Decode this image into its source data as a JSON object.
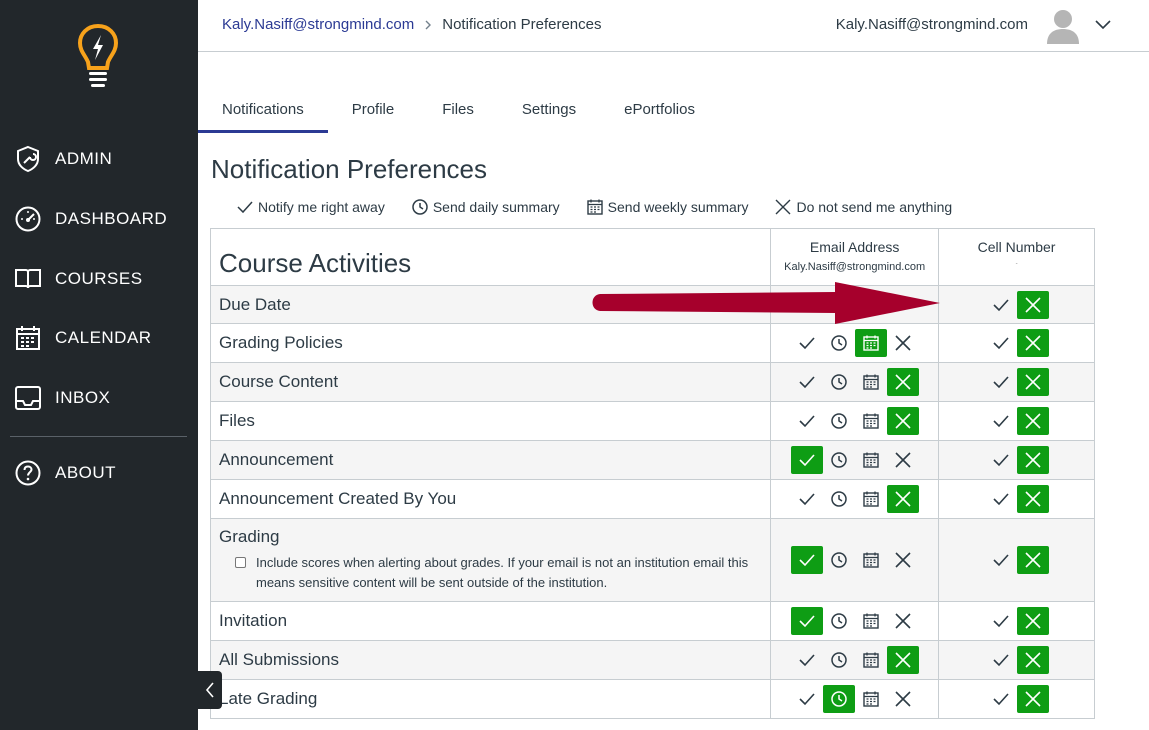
{
  "sidebar": {
    "items": [
      {
        "label": "ADMIN",
        "icon": "shield-wrench-icon"
      },
      {
        "label": "DASHBOARD",
        "icon": "speedometer-icon"
      },
      {
        "label": "COURSES",
        "icon": "book-icon"
      },
      {
        "label": "CALENDAR",
        "icon": "calendar-icon"
      },
      {
        "label": "INBOX",
        "icon": "inbox-icon"
      },
      {
        "label": "ABOUT",
        "icon": "help-icon"
      }
    ],
    "logo": "lightbulb-logo-icon",
    "colors": {
      "background": "#22272b",
      "logo": "#f7a21b"
    }
  },
  "header": {
    "breadcrumb_link": "Kaly.Nasiff@strongmind.com",
    "breadcrumb_current": "Notification Preferences",
    "user_email": "Kaly.Nasiff@strongmind.com"
  },
  "tabs": [
    {
      "label": "Notifications",
      "active": true
    },
    {
      "label": "Profile",
      "active": false
    },
    {
      "label": "Files",
      "active": false
    },
    {
      "label": "Settings",
      "active": false
    },
    {
      "label": "ePortfolios",
      "active": false
    }
  ],
  "page_title": "Notification Preferences",
  "legend": {
    "right_away": "Notify me right away",
    "daily": "Send daily summary",
    "weekly": "Send weekly summary",
    "never": "Do not send me anything"
  },
  "table": {
    "title": "Course Activities",
    "email_col": "Email Address",
    "email_value": "Kaly.Nasiff@strongmind.com",
    "cell_col": "Cell Number",
    "cell_value": "-",
    "rows": [
      {
        "name": "Due Date",
        "email": null,
        "cell": "never"
      },
      {
        "name": "Grading Policies",
        "email": "weekly",
        "cell": "never"
      },
      {
        "name": "Course Content",
        "email": "never",
        "cell": "never"
      },
      {
        "name": "Files",
        "email": "never",
        "cell": "never"
      },
      {
        "name": "Announcement",
        "email": "immediate",
        "cell": "never"
      },
      {
        "name": "Announcement Created By You",
        "email": "never",
        "cell": "never"
      },
      {
        "name": "Grading",
        "email": "immediate",
        "cell": "never"
      },
      {
        "name": "Invitation",
        "email": "immediate",
        "cell": "never"
      },
      {
        "name": "All Submissions",
        "email": "never",
        "cell": "never"
      },
      {
        "name": "Late Grading",
        "email": "daily",
        "cell": "never"
      }
    ],
    "grading_note": "Include scores when alerting about grades. If your email is not an institution email this means sensitive content will be sent outside of the institution."
  },
  "colors": {
    "accent": "#2b3a94",
    "selected": "#0e9d14",
    "arrow": "#a6002c"
  }
}
